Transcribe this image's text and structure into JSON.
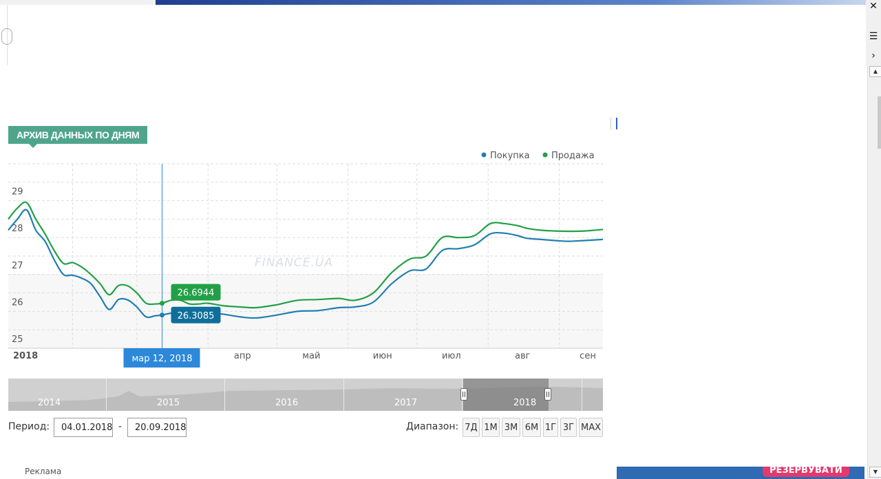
{
  "section_title": "АРХИВ ДАННЫХ ПО ДНЯМ",
  "watermark": "FINANCE.UA",
  "tooltip": {
    "date": "мар 12, 2018",
    "sell_value": "26.6944",
    "buy_value": "26.3085"
  },
  "period": {
    "label": "Период:",
    "from": "04.01.2018",
    "separator": "-",
    "to": "20.09.2018"
  },
  "range": {
    "label": "Диапазон:",
    "buttons": [
      "7Д",
      "1М",
      "3М",
      "6М",
      "1Г",
      "3Г",
      "MAX"
    ]
  },
  "navigator": {
    "years": [
      "2014",
      "2015",
      "2016",
      "2017",
      "2018"
    ],
    "selected_year": "2018"
  },
  "ad_label": "Реклама",
  "banner_text": "РЕЗЕРВУВАТИ",
  "colors": {
    "buy": "#1f7fb0",
    "sell": "#21a046",
    "title_bg": "#4fa58c",
    "tooltip_date_bg": "#2c88d9"
  },
  "chart_data": {
    "type": "line",
    "year_label": "2018",
    "x_labels": [
      "апр",
      "май",
      "июн",
      "июл",
      "авг",
      "сен"
    ],
    "y_ticks": [
      25,
      26,
      27,
      28,
      29
    ],
    "ylim": [
      25,
      30
    ],
    "xlim": [
      "2018-01-04",
      "2018-09-20"
    ],
    "legend": {
      "position": "top-right",
      "entries": [
        "Покупка",
        "Продажа"
      ]
    },
    "grid": true,
    "series": [
      {
        "name": "Покупка",
        "color": "#1f7fb0",
        "x": [
          "2018-01-04",
          "2018-01-08",
          "2018-01-12",
          "2018-01-16",
          "2018-01-20",
          "2018-01-24",
          "2018-01-28",
          "2018-02-01",
          "2018-02-05",
          "2018-02-09",
          "2018-02-13",
          "2018-02-17",
          "2018-02-21",
          "2018-02-25",
          "2018-03-01",
          "2018-03-05",
          "2018-03-09",
          "2018-03-12",
          "2018-03-16",
          "2018-03-20",
          "2018-03-24",
          "2018-03-28",
          "2018-04-01",
          "2018-04-08",
          "2018-04-15",
          "2018-04-22",
          "2018-05-01",
          "2018-05-10",
          "2018-05-19",
          "2018-05-28",
          "2018-06-04",
          "2018-06-12",
          "2018-06-20",
          "2018-06-28",
          "2018-07-05",
          "2018-07-12",
          "2018-07-19",
          "2018-07-26",
          "2018-08-02",
          "2018-08-08",
          "2018-08-14",
          "2018-08-18",
          "2018-08-24",
          "2018-08-30",
          "2018-09-05",
          "2018-09-12",
          "2018-09-20"
        ],
        "y": [
          28.2,
          28.5,
          28.75,
          28.2,
          27.9,
          27.4,
          27.0,
          26.98,
          26.9,
          26.75,
          26.4,
          26.05,
          26.32,
          26.31,
          26.12,
          25.85,
          25.88,
          25.9,
          25.95,
          25.92,
          25.92,
          25.98,
          25.97,
          25.92,
          25.85,
          25.82,
          25.9,
          26.0,
          26.02,
          26.1,
          26.12,
          26.25,
          26.75,
          27.1,
          27.15,
          27.65,
          27.7,
          27.8,
          28.1,
          28.12,
          28.05,
          27.98,
          27.95,
          27.92,
          27.9,
          27.92,
          27.95
        ]
      },
      {
        "name": "Продажа",
        "color": "#21a046",
        "x": [
          "2018-01-04",
          "2018-01-08",
          "2018-01-12",
          "2018-01-16",
          "2018-01-20",
          "2018-01-24",
          "2018-01-28",
          "2018-02-01",
          "2018-02-05",
          "2018-02-09",
          "2018-02-13",
          "2018-02-17",
          "2018-02-21",
          "2018-02-25",
          "2018-03-01",
          "2018-03-05",
          "2018-03-09",
          "2018-03-12",
          "2018-03-16",
          "2018-03-20",
          "2018-03-24",
          "2018-03-28",
          "2018-04-01",
          "2018-04-08",
          "2018-04-15",
          "2018-04-22",
          "2018-05-01",
          "2018-05-10",
          "2018-05-19",
          "2018-05-28",
          "2018-06-04",
          "2018-06-12",
          "2018-06-20",
          "2018-06-28",
          "2018-07-05",
          "2018-07-12",
          "2018-07-19",
          "2018-07-26",
          "2018-08-02",
          "2018-08-08",
          "2018-08-14",
          "2018-08-18",
          "2018-08-24",
          "2018-08-30",
          "2018-09-05",
          "2018-09-12",
          "2018-09-20"
        ],
        "y": [
          28.5,
          28.8,
          28.95,
          28.5,
          28.1,
          27.65,
          27.3,
          27.32,
          27.2,
          27.0,
          26.75,
          26.45,
          26.7,
          26.69,
          26.5,
          26.22,
          26.2,
          26.22,
          26.3,
          26.3,
          26.2,
          26.2,
          26.22,
          26.15,
          26.12,
          26.1,
          26.18,
          26.3,
          26.32,
          26.35,
          26.3,
          26.5,
          27.05,
          27.42,
          27.5,
          28.0,
          28.0,
          28.05,
          28.38,
          28.38,
          28.32,
          28.25,
          28.2,
          28.18,
          28.17,
          28.18,
          28.22
        ]
      }
    ]
  }
}
